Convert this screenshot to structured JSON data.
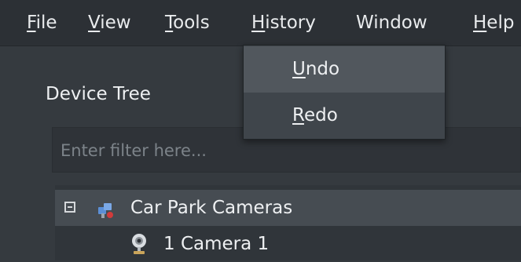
{
  "menubar": {
    "items": [
      {
        "label": "File",
        "mnemonic": "F",
        "rest": "ile"
      },
      {
        "label": "View",
        "mnemonic": "V",
        "rest": "iew"
      },
      {
        "label": "Tools",
        "mnemonic": "T",
        "rest": "ools"
      },
      {
        "label": "History",
        "mnemonic": "H",
        "rest": "istory"
      },
      {
        "label": "Window",
        "mnemonic": "",
        "rest": "Window"
      },
      {
        "label": "Help",
        "mnemonic": "H",
        "rest": "elp"
      }
    ]
  },
  "history_menu": {
    "items": [
      {
        "label": "Undo",
        "mnemonic": "U",
        "rest": "ndo"
      },
      {
        "label": "Redo",
        "mnemonic": "R",
        "rest": "edo"
      }
    ]
  },
  "device_tree": {
    "title": "Device Tree",
    "filter_placeholder": "Enter filter here...",
    "filter_value": "",
    "rows": [
      {
        "label": "Car Park Cameras",
        "icon": "camera-group-icon",
        "expanded": true
      },
      {
        "label": "1 Camera 1",
        "icon": "webcam-icon"
      }
    ]
  },
  "colors": {
    "menubar_bg": "#2c3035",
    "window_bg": "#353a3f",
    "menu_bg": "#3f454b",
    "menu_highlight": "#51575d",
    "selected_row": "#464c52"
  }
}
